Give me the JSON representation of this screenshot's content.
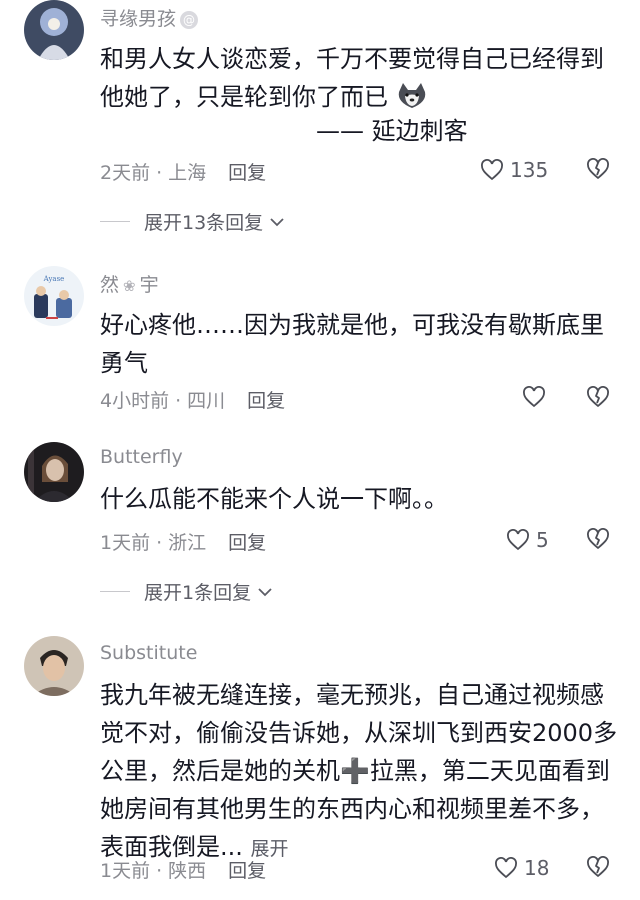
{
  "comments": [
    {
      "username": "寻缘男孩",
      "badge": "@",
      "text": "和男人女人谈恋爱，千万不要觉得自己已经得到他她了，只是轮到你了而已",
      "signature": "—— 延边刺客",
      "time": "2天前",
      "location": "上海",
      "reply": "回复",
      "likes": "135",
      "expand": "展开13条回复"
    },
    {
      "username_a": "然",
      "username_b": "宇",
      "text": "好心疼他……因为我就是他，可我没有歇斯底里勇气",
      "time": "4小时前",
      "location": "四川",
      "reply": "回复"
    },
    {
      "username": "Butterfly",
      "text": "什么瓜能不能来个人说一下啊。。",
      "time": "1天前",
      "location": "浙江",
      "reply": "回复",
      "likes": "5",
      "expand": "展开1条回复"
    },
    {
      "username": "Substitute",
      "text": "我九年被无缝连接，毫无预兆，自己通过视频感觉不对，偷偷没告诉她，从深圳飞到西安2000多公里，然后是她的关机➕拉黑，第二天见面看到她房间有其他男生的东西内心和视频里差不多，表面我倒是...",
      "more": "展开",
      "time": "1天前",
      "location": "陕西",
      "reply": "回复",
      "likes": "18"
    }
  ],
  "colors": {
    "text": "#161823",
    "secondary": "#8a8b91"
  },
  "icons": [
    "heart-icon",
    "broken-heart-icon",
    "chevron-down-icon",
    "dog-emoji-icon"
  ]
}
